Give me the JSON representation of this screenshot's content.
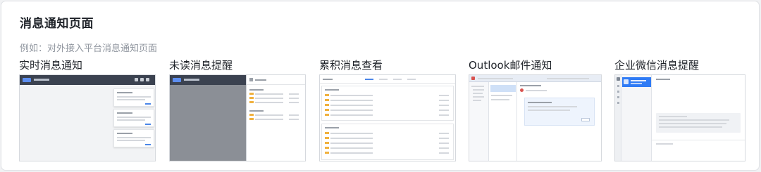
{
  "section": {
    "title": "消息通知页面",
    "subtitle": "例如：对外接入平台消息通知页面"
  },
  "examples": [
    {
      "label": "实时消息通知"
    },
    {
      "label": "未读消息提醒"
    },
    {
      "label": "累积消息查看"
    },
    {
      "label": "Outlook邮件通知"
    },
    {
      "label": "企业微信消息提醒"
    }
  ],
  "colors": {
    "card_bg": "#ffffff",
    "page_bg": "#f1f2f4",
    "topbar": "#3b4250",
    "accent_blue": "#4a86e8",
    "tag_orange": "#f0b13e",
    "overlay_gray": "#8b8f96"
  }
}
